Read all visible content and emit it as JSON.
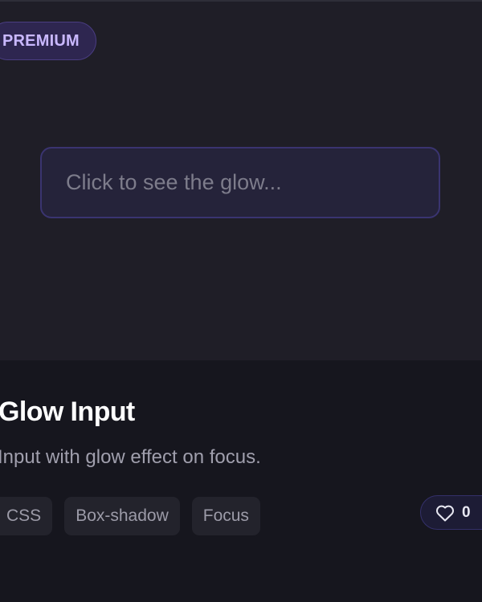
{
  "badge": {
    "label": "PREMIUM"
  },
  "preview": {
    "input_placeholder": "Click to see the glow..."
  },
  "info": {
    "title": "Glow Input",
    "description": "Input with glow effect on focus.",
    "tags": [
      "CSS",
      "Box-shadow",
      "Focus"
    ],
    "likes": {
      "icon": "heart-outline-icon",
      "count": "0"
    }
  },
  "colors": {
    "background": "#16161e",
    "preview_background": "#1f1e27",
    "badge_background": "#2e2650",
    "badge_text": "#c9b8ff",
    "input_border": "#3a3470",
    "tag_background": "#23232c",
    "like_background": "#1d1c35"
  }
}
